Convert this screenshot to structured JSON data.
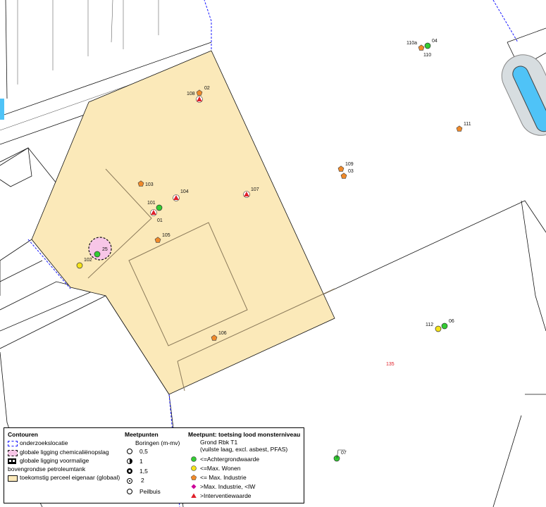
{
  "map": {
    "parcel_number": "135",
    "colors": {
      "parcel_fill": "#fbe9b9",
      "parcel_line": "#8b7a5a",
      "boundary_line": "#1a1aff",
      "cadastre_line": "#111111",
      "water": "#4fc3f7",
      "green": "#33cc33",
      "yellow": "#f5e31a",
      "orange": "#f08a2a",
      "magenta": "#cc0099",
      "red": "#e0202a",
      "parcel_number_color": "#e0202a"
    },
    "points": [
      {
        "id": "02",
        "category": "orange"
      },
      {
        "id": "108",
        "category": "red"
      },
      {
        "id": "110a",
        "category": "orange"
      },
      {
        "id": "04",
        "category": "green"
      },
      {
        "id": "110",
        "category": "label"
      },
      {
        "id": "111",
        "category": "orange"
      },
      {
        "id": "109",
        "category": "orange"
      },
      {
        "id": "03",
        "category": "orange"
      },
      {
        "id": "103",
        "category": "orange"
      },
      {
        "id": "104",
        "category": "red"
      },
      {
        "id": "107",
        "category": "red"
      },
      {
        "id": "101",
        "category": "green"
      },
      {
        "id": "01",
        "category": "red"
      },
      {
        "id": "105",
        "category": "orange"
      },
      {
        "id": "25",
        "category": "green"
      },
      {
        "id": "102",
        "category": "yellow"
      },
      {
        "id": "112",
        "category": "yellow"
      },
      {
        "id": "06",
        "category": "green"
      },
      {
        "id": "106",
        "category": "orange"
      },
      {
        "id": "07",
        "category": "green"
      }
    ]
  },
  "legend": {
    "contouren": {
      "title": "Contouren",
      "items": [
        "onderzoekslocatie",
        "globale ligging chemicaliënopslag",
        "globale ligging voormalige",
        "bovengrondse petroleumtank",
        "toekomstig perceel eigenaar (globaal)"
      ]
    },
    "meetpunten": {
      "title": "Meetpunten",
      "subtitle": "Boringen (m-mv)",
      "depths": [
        "0,5",
        "1",
        "1,5",
        "2"
      ],
      "peilbuis": "Peilbuis"
    },
    "toetsing": {
      "title": "Meetpunt: toetsing lood monsterniveau",
      "line1": "Grond Rbk T1",
      "line2": "(vuilste laag, excl. asbest, PFAS)",
      "items": [
        "<=Achtergrondwaarde",
        "<=Max. Wonen",
        "<= Max. Industrie",
        ">Max. Industrie, <IW",
        ">Interventiewaarde"
      ]
    }
  }
}
